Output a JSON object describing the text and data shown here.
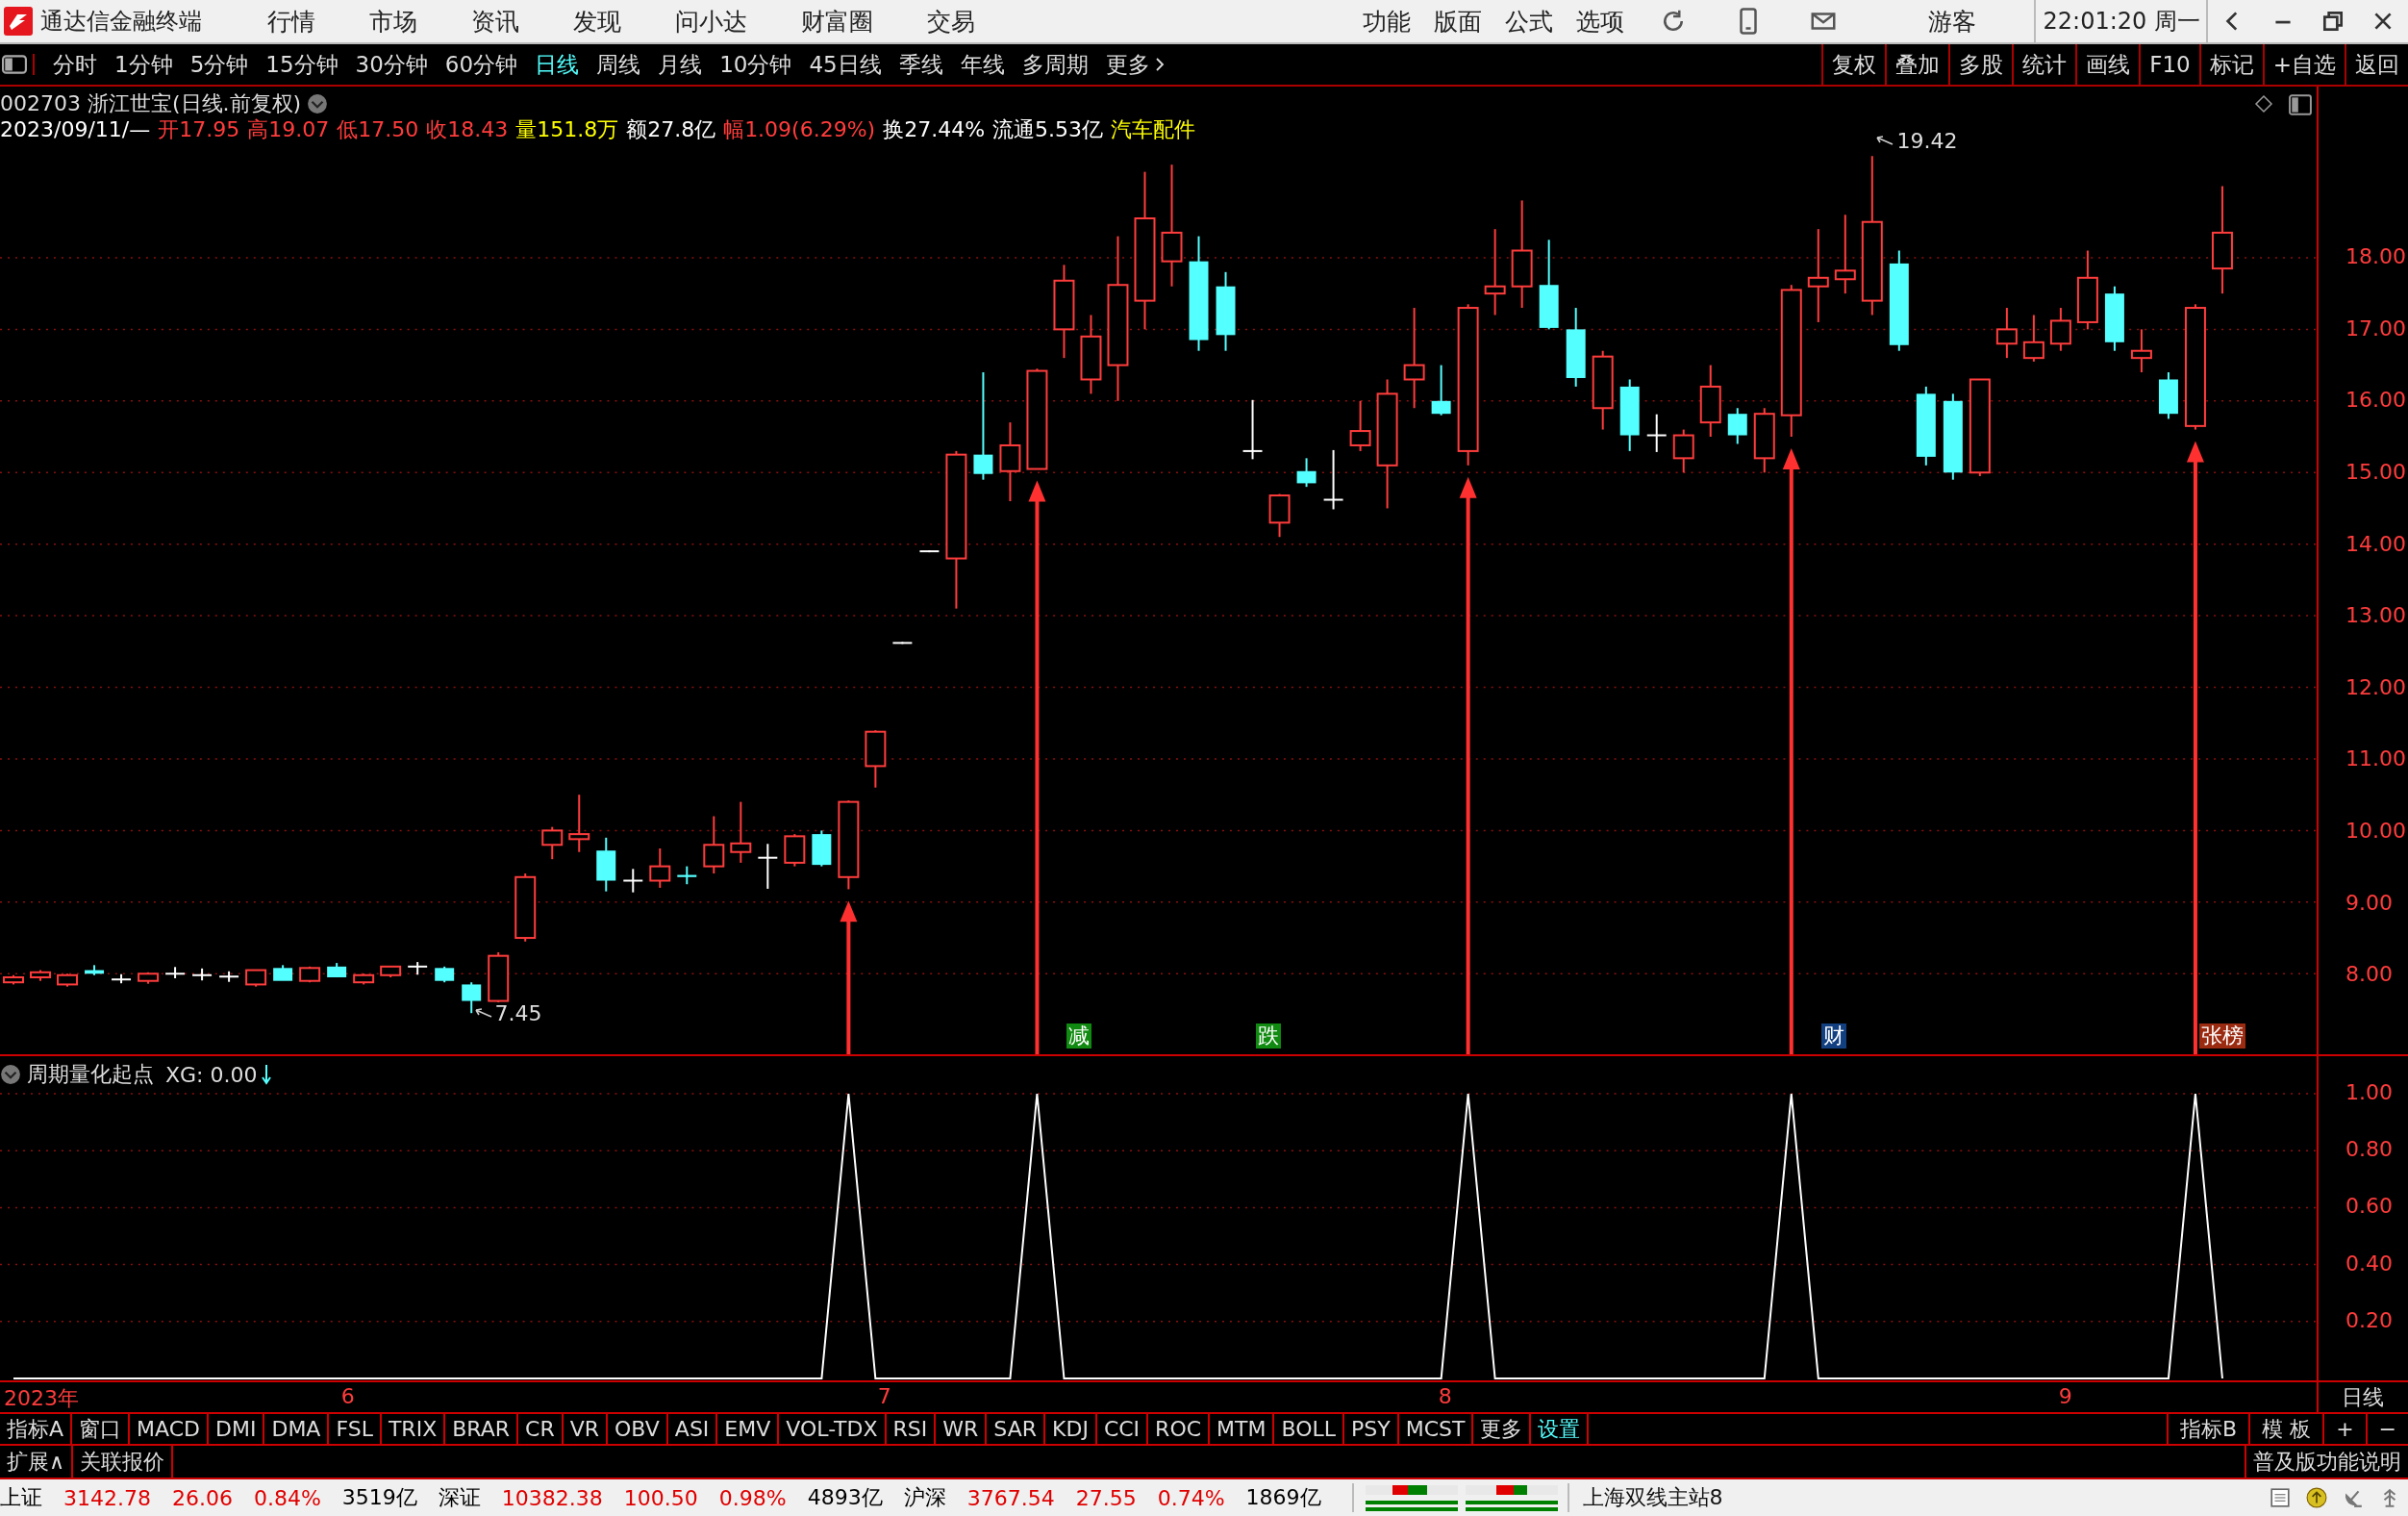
{
  "title_bar": {
    "app_name": "通达信金融终端",
    "menus": [
      "行情",
      "市场",
      "资讯",
      "发现",
      "问小达",
      "财富圈",
      "交易"
    ],
    "right_menus": [
      "功能",
      "版面",
      "公式",
      "选项"
    ],
    "user": "游客",
    "clock": "22:01:20 周一"
  },
  "toolbar": {
    "periods": [
      {
        "label": "分时",
        "selected": false
      },
      {
        "label": "1分钟",
        "selected": false
      },
      {
        "label": "5分钟",
        "selected": false
      },
      {
        "label": "15分钟",
        "selected": false
      },
      {
        "label": "30分钟",
        "selected": false
      },
      {
        "label": "60分钟",
        "selected": false
      },
      {
        "label": "日线",
        "selected": true
      },
      {
        "label": "周线",
        "selected": false
      },
      {
        "label": "月线",
        "selected": false
      },
      {
        "label": "10分钟",
        "selected": false
      },
      {
        "label": "45日线",
        "selected": false
      },
      {
        "label": "季线",
        "selected": false
      },
      {
        "label": "年线",
        "selected": false
      },
      {
        "label": "多周期",
        "selected": false
      },
      {
        "label": "更多",
        "selected": false
      }
    ],
    "actions": [
      "复权",
      "叠加",
      "多股",
      "统计",
      "画线",
      "F10",
      "标记",
      "+自选",
      "返回"
    ]
  },
  "chart_header": {
    "title": "002703 浙江世宝(日线.前复权)",
    "quote": [
      {
        "text": "2023/09/11/—",
        "color": "#ffffff"
      },
      {
        "text": "开17.95",
        "color": "#ff3c3c"
      },
      {
        "text": "高19.07",
        "color": "#ff3c3c"
      },
      {
        "text": "低17.50",
        "color": "#ff3c3c"
      },
      {
        "text": "收18.43",
        "color": "#ff3c3c"
      },
      {
        "text": "量151.8万",
        "color": "#ffff00"
      },
      {
        "text": "额27.8亿",
        "color": "#ffffff"
      },
      {
        "text": "幅1.09(6.29%)",
        "color": "#ff3c3c"
      },
      {
        "text": "换27.44%",
        "color": "#ffffff"
      },
      {
        "text": "流通5.53亿",
        "color": "#ffffff"
      },
      {
        "text": "汽车配件",
        "color": "#ffff00"
      }
    ]
  },
  "price_axis": [
    "18.00",
    "17.00",
    "16.00",
    "15.00",
    "14.00",
    "13.00",
    "12.00",
    "11.00",
    "10.00",
    "9.00",
    "8.00"
  ],
  "price_marks": [
    {
      "text": "19.42"
    },
    {
      "text": "7.45"
    }
  ],
  "event_tags": [
    {
      "text": "减",
      "color": "#108a10"
    },
    {
      "text": "跌",
      "color": "#108a10"
    },
    {
      "text": "财",
      "color": "#123f80"
    },
    {
      "text": "张榜",
      "color": "#9a2a10"
    }
  ],
  "indicator": {
    "name": "周期量化起点",
    "reading": ": 0.00",
    "chart_data": {
      "type": "line",
      "grid": true,
      "ylim": [
        0,
        1
      ],
      "yticks": [
        {
          "value": 1,
          "label": "1.00"
        },
        {
          "value": 0.8,
          "label": "0.80"
        },
        {
          "value": 0.6,
          "label": "0.60"
        },
        {
          "value": 0.4,
          "label": "0.40"
        },
        {
          "value": 0.2,
          "label": "0.20"
        }
      ],
      "series": [
        {
          "name": "XG",
          "color": "#ffffff",
          "values": [
            0,
            0,
            0,
            0,
            0,
            0,
            0,
            0,
            0,
            0,
            0,
            0,
            0,
            0,
            0,
            0,
            0,
            0,
            0,
            0,
            0,
            0,
            0,
            0,
            0,
            0,
            0,
            0,
            0,
            0,
            0,
            1,
            0,
            0,
            0,
            0,
            0,
            0,
            1,
            0,
            0,
            0,
            0,
            0,
            0,
            0,
            0,
            0,
            0,
            0,
            0,
            0,
            0,
            0,
            1,
            0,
            0,
            0,
            0,
            0,
            0,
            0,
            0,
            0,
            0,
            0,
            1,
            0,
            0,
            0,
            0,
            0,
            0,
            0,
            0,
            0,
            0,
            0,
            0,
            0,
            0,
            1,
            0,
            null,
            null,
            null
          ]
        }
      ]
    }
  },
  "date_axis": {
    "labels": [
      "2023年",
      "6",
      "7",
      "8",
      "9"
    ],
    "period": "日线"
  },
  "indicator_tabs": [
    {
      "label": "指标A",
      "selected": false
    },
    {
      "label": "窗口",
      "selected": false
    },
    {
      "label": "MACD",
      "selected": false
    },
    {
      "label": "DMI",
      "selected": false
    },
    {
      "label": "DMA",
      "selected": false
    },
    {
      "label": "FSL",
      "selected": false
    },
    {
      "label": "TRIX",
      "selected": false
    },
    {
      "label": "BRAR",
      "selected": false
    },
    {
      "label": "CR",
      "selected": false
    },
    {
      "label": "VR",
      "selected": false
    },
    {
      "label": "OBV",
      "selected": false
    },
    {
      "label": "ASI",
      "selected": false
    },
    {
      "label": "EMV",
      "selected": false
    },
    {
      "label": "VOL-TDX",
      "selected": false
    },
    {
      "label": "RSI",
      "selected": false
    },
    {
      "label": "WR",
      "selected": false
    },
    {
      "label": "SAR",
      "selected": false
    },
    {
      "label": "KDJ",
      "selected": false
    },
    {
      "label": "CCI",
      "selected": false
    },
    {
      "label": "ROC",
      "selected": false
    },
    {
      "label": "MTM",
      "selected": false
    },
    {
      "label": "BOLL",
      "selected": false
    },
    {
      "label": "PSY",
      "selected": false
    },
    {
      "label": "MCST",
      "selected": false
    },
    {
      "label": "更多",
      "selected": false
    },
    {
      "label": "设置",
      "selected": true
    }
  ],
  "indicator_tabs_right": [
    "指标B",
    "模 板",
    "+",
    "−"
  ],
  "extension_row": {
    "tabs": [
      "扩展∧",
      "关联报价"
    ],
    "help": "普及版功能说明"
  },
  "status_bar": {
    "quotes": [
      {
        "text": "上证",
        "color": "#000000"
      },
      {
        "text": "3142.78",
        "color": "#e00000"
      },
      {
        "text": "26.06",
        "color": "#e00000"
      },
      {
        "text": "0.84%",
        "color": "#e00000"
      },
      {
        "text": "3519亿",
        "color": "#000000"
      },
      {
        "text": "深证",
        "color": "#000000"
      },
      {
        "text": "10382.38",
        "color": "#e00000"
      },
      {
        "text": "100.50",
        "color": "#e00000"
      },
      {
        "text": "0.98%",
        "color": "#e00000"
      },
      {
        "text": "4893亿",
        "color": "#000000"
      },
      {
        "text": "沪深",
        "color": "#000000"
      },
      {
        "text": "3767.54",
        "color": "#e00000"
      },
      {
        "text": "27.55",
        "color": "#e00000"
      },
      {
        "text": "0.74%",
        "color": "#e00000"
      },
      {
        "text": "1869亿",
        "color": "#000000"
      }
    ],
    "server": "上海双线主站8"
  }
}
